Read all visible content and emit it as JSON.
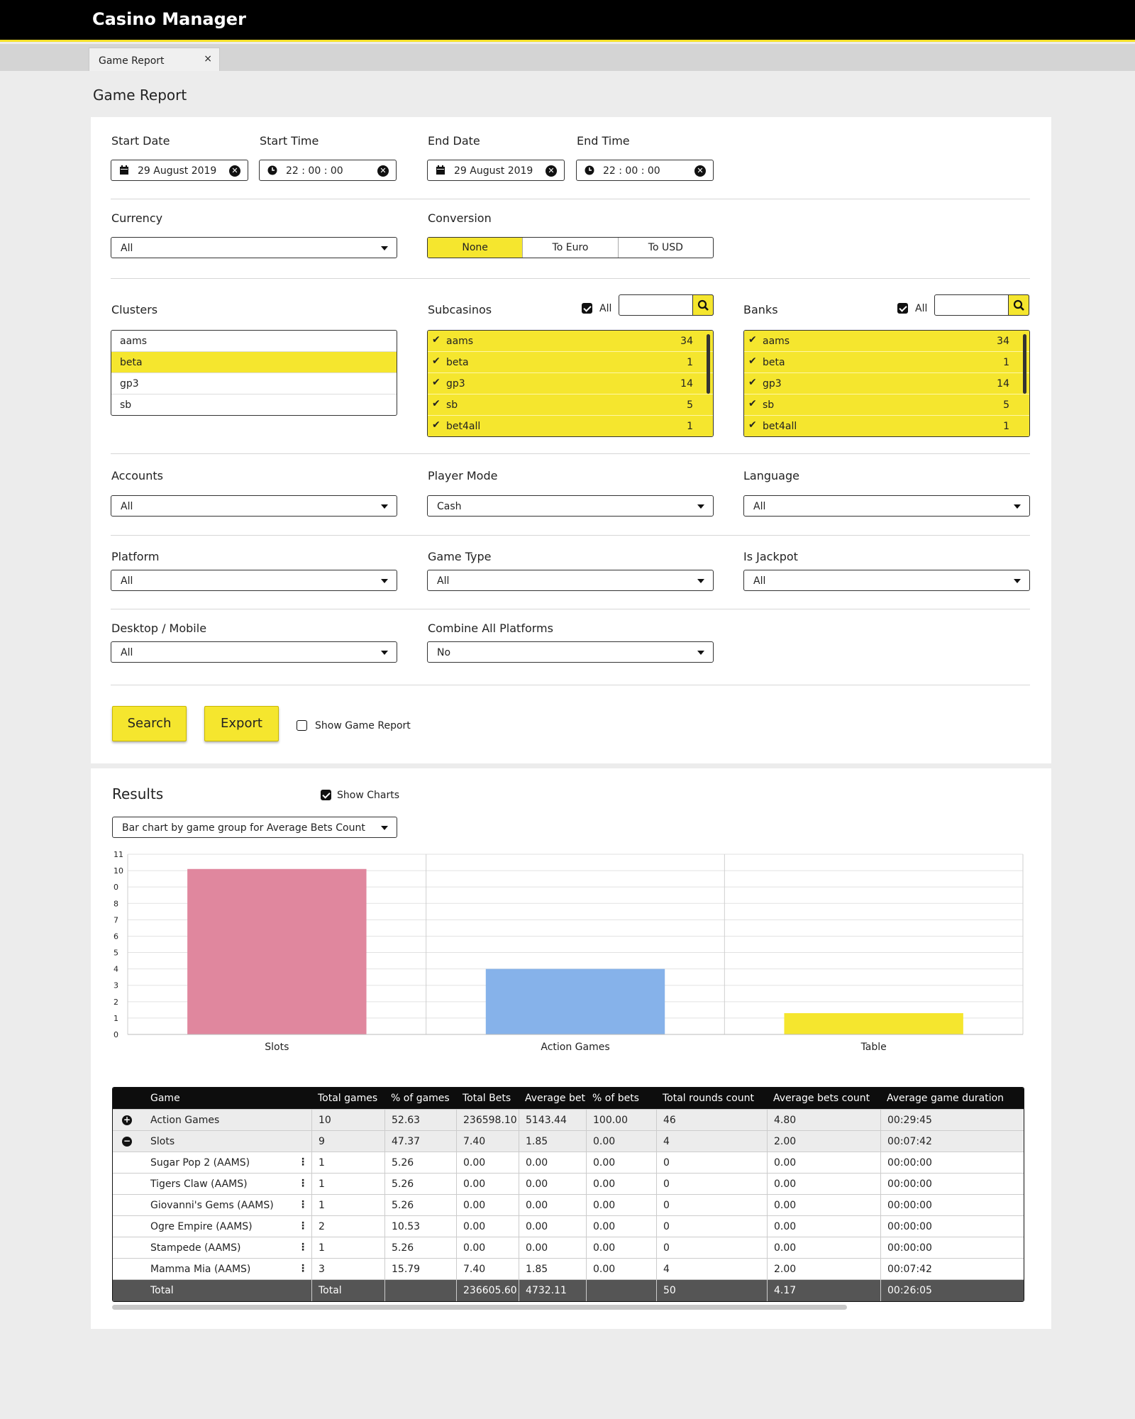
{
  "app": {
    "title": "Casino Manager"
  },
  "tabs": [
    {
      "label": "Game Report",
      "close": "×"
    }
  ],
  "page": {
    "title": "Game Report"
  },
  "filters": {
    "start_date": {
      "label": "Start Date",
      "value": "29 August 2019"
    },
    "start_time": {
      "label": "Start Time",
      "value": "22 : 00 : 00"
    },
    "end_date": {
      "label": "End Date",
      "value": "29 August 2019"
    },
    "end_time": {
      "label": "End Time",
      "value": "22 : 00 : 00"
    },
    "currency": {
      "label": "Currency",
      "value": "All"
    },
    "conversion": {
      "label": "Conversion",
      "options": [
        "None",
        "To Euro",
        "To USD"
      ],
      "selected": "None"
    },
    "clusters": {
      "label": "Clusters",
      "items": [
        "aams",
        "beta",
        "gp3",
        "sb"
      ],
      "selected": "beta"
    },
    "subcasinos": {
      "label": "Subcasinos",
      "all_label": "All",
      "all_checked": true,
      "items": [
        {
          "name": "aams",
          "count": "34"
        },
        {
          "name": "beta",
          "count": "1"
        },
        {
          "name": "gp3",
          "count": "14"
        },
        {
          "name": "sb",
          "count": "5"
        },
        {
          "name": "bet4all",
          "count": "1"
        }
      ]
    },
    "banks": {
      "label": "Banks",
      "all_label": "All",
      "all_checked": true,
      "items": [
        {
          "name": "aams",
          "count": "34"
        },
        {
          "name": "beta",
          "count": "1"
        },
        {
          "name": "gp3",
          "count": "14"
        },
        {
          "name": "sb",
          "count": "5"
        },
        {
          "name": "bet4all",
          "count": "1"
        }
      ]
    },
    "accounts": {
      "label": "Accounts",
      "value": "All"
    },
    "player_mode": {
      "label": "Player Mode",
      "value": "Cash"
    },
    "language": {
      "label": "Language",
      "value": "All"
    },
    "platform": {
      "label": "Platform",
      "value": "All"
    },
    "game_type": {
      "label": "Game Type",
      "value": "All"
    },
    "is_jackpot": {
      "label": "Is Jackpot",
      "value": "All"
    },
    "desktop_mobile": {
      "label": "Desktop / Mobile",
      "value": "All"
    },
    "combine_platforms": {
      "label": "Combine All Platforms",
      "value": "No"
    }
  },
  "actions": {
    "search": "Search",
    "export": "Export",
    "show_game_report": "Show Game Report",
    "show_game_report_checked": false
  },
  "results": {
    "title": "Results",
    "show_charts": "Show Charts",
    "show_charts_checked": true,
    "chart_select": "Bar chart by game group for Average Bets Count"
  },
  "chart_data": {
    "type": "bar",
    "categories": [
      "Slots",
      "Action Games",
      "Table"
    ],
    "values": [
      10.1,
      4,
      1.3
    ],
    "colors": [
      "#e0879e",
      "#86b2ea",
      "#f5e62e"
    ],
    "y_ticks": [
      "0",
      "1",
      "2",
      "3",
      "4",
      "5",
      "6",
      "7",
      "8",
      "0",
      "10",
      "11"
    ],
    "ylim": [
      0,
      11
    ],
    "grid": true
  },
  "table": {
    "columns": [
      "Game",
      "Total games",
      "% of games",
      "Total Bets",
      "Average bet",
      "% of bets",
      "Total rounds count",
      "Average bets count",
      "Average game duration"
    ],
    "rows": [
      {
        "type": "group",
        "expander": "+",
        "cells": [
          "Action Games",
          "10",
          "52.63",
          "236598.10",
          "5143.44",
          "100.00",
          "46",
          "4.80",
          "00:29:45"
        ]
      },
      {
        "type": "group",
        "expander": "−",
        "cells": [
          "Slots",
          "9",
          "47.37",
          "7.40",
          "1.85",
          "0.00",
          "4",
          "2.00",
          "00:07:42"
        ]
      },
      {
        "type": "item",
        "cells": [
          "Sugar Pop 2 (AAMS)",
          "1",
          "5.26",
          "0.00",
          "0.00",
          "0.00",
          "0",
          "0.00",
          "00:00:00"
        ]
      },
      {
        "type": "item",
        "cells": [
          "Tigers Claw (AAMS)",
          "1",
          "5.26",
          "0.00",
          "0.00",
          "0.00",
          "0",
          "0.00",
          "00:00:00"
        ]
      },
      {
        "type": "item",
        "cells": [
          "Giovanni's Gems (AAMS)",
          "1",
          "5.26",
          "0.00",
          "0.00",
          "0.00",
          "0",
          "0.00",
          "00:00:00"
        ]
      },
      {
        "type": "item",
        "cells": [
          "Ogre Empire (AAMS)",
          "2",
          "10.53",
          "0.00",
          "0.00",
          "0.00",
          "0",
          "0.00",
          "00:00:00"
        ]
      },
      {
        "type": "item",
        "cells": [
          "Stampede (AAMS)",
          "1",
          "5.26",
          "0.00",
          "0.00",
          "0.00",
          "0",
          "0.00",
          "00:00:00"
        ]
      },
      {
        "type": "item",
        "cells": [
          "Mamma Mia (AAMS)",
          "3",
          "15.79",
          "7.40",
          "1.85",
          "0.00",
          "4",
          "2.00",
          "00:07:42"
        ]
      }
    ],
    "total": [
      "Total",
      "Total",
      "",
      "236605.60",
      "4732.11",
      "",
      "50",
      "4.17",
      "00:26:05"
    ]
  }
}
